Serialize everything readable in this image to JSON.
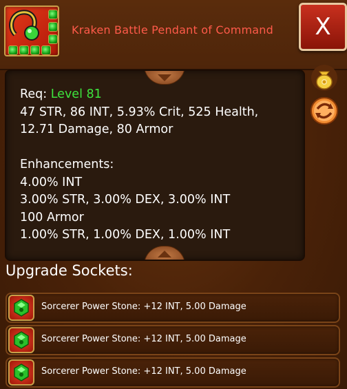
{
  "item": {
    "title": "Kraken Battle Pendant of Command",
    "icon": "pendant-icon",
    "title_color": "#ff5a4a"
  },
  "close_label": "X",
  "stats": {
    "req_label": "Req:",
    "req_value": "Level 81",
    "line1": "47 STR, 86 INT, 5.93% Crit, 525 Health,",
    "line2": "12.71 Damage, 80 Armor",
    "enh_title": "Enhancements:",
    "enhancements": [
      "4.00% INT",
      "3.00% STR, 3.00% DEX, 3.00% INT",
      "100 Armor",
      "1.00% STR, 1.00% DEX, 1.00% INT"
    ],
    "req_color": "#3ee53e"
  },
  "side_buttons": [
    {
      "icon": "gold-bag-icon"
    },
    {
      "icon": "swap-arrows-icon"
    }
  ],
  "sockets": {
    "label": "Upgrade Sockets:",
    "items": [
      {
        "text": "Sorcerer Power Stone: +12 INT, 5.00 Damage",
        "icon": "power-stone-icon"
      },
      {
        "text": "Sorcerer Power Stone: +12 INT, 5.00 Damage",
        "icon": "power-stone-icon"
      },
      {
        "text": "Sorcerer Power Stone: +12 INT, 5.00 Damage",
        "icon": "power-stone-icon"
      }
    ]
  }
}
